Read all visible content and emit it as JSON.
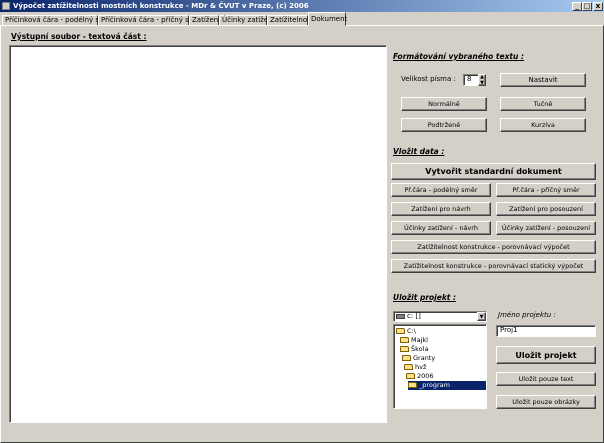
{
  "window": {
    "title": "Výpočet zatížitelnosti mostních konstrukce  -  MDr & ČVUT v Praze, (c) 2006",
    "minimize": "_",
    "maximize": "□",
    "close": "x"
  },
  "tabs": [
    {
      "label": "Příčinková čára - podélný směr"
    },
    {
      "label": "Příčinková čára - příčný směr"
    },
    {
      "label": "Zatížení"
    },
    {
      "label": "Účinky zatížení"
    },
    {
      "label": "Zatížitelnost"
    },
    {
      "label": "Dokument"
    }
  ],
  "output": {
    "heading": "Výstupní soubor - textová část :",
    "content": ""
  },
  "formatting": {
    "heading": "Formátování vybraného textu :",
    "font_size_label": "Velikost písma :",
    "font_size_value": "8",
    "set_button": "Nastavit",
    "normal_button": "Normálně",
    "bold_button": "Tučně",
    "underline_button": "Podtrženě",
    "italic_button": "Kurzíva"
  },
  "insert": {
    "heading": "Vložit data :",
    "create_button": "Vytvořit standardní dokument",
    "buttons": [
      "Př.čára - podélný směr",
      "Př.čára - příčný směr",
      "Zatížení pro návrh",
      "Zatížení pro posouzení",
      "Účinky zatížení - návrh",
      "Účinky zatížení - posouzení",
      "Zatížitelnost konstrukce - porovnávací výpočet",
      "Zatížitelnost konstrukce - porovnávací statický výpočet"
    ]
  },
  "save": {
    "heading": "Uložit projekt :",
    "drive_value": "c: []",
    "tree": [
      "C:\\",
      "Majkl",
      "Škola",
      "Granty",
      "hvž",
      "2006",
      "_program"
    ],
    "selected_index": 6,
    "project_name_label": "Jméno projektu :",
    "project_name_value": "Proj1",
    "save_button": "Uložit projekt",
    "save_text_button": "Uložit pouze text",
    "save_images_button": "Uložit pouze obrázky"
  }
}
